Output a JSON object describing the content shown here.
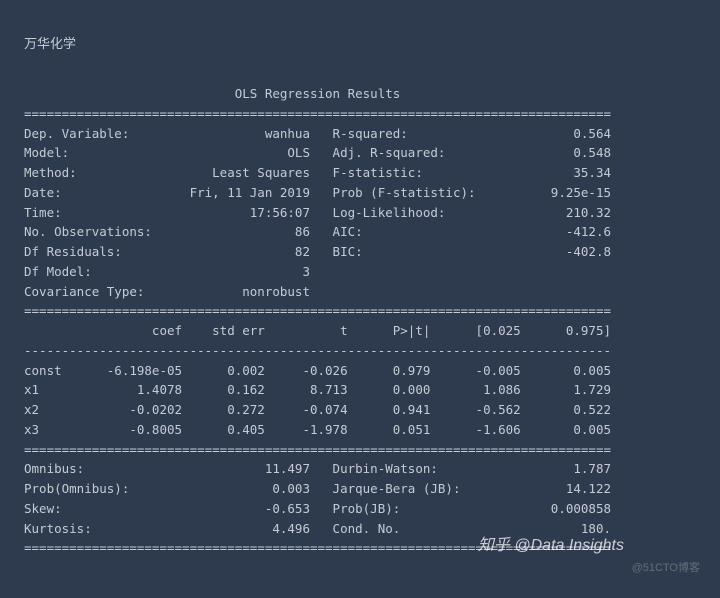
{
  "company_name_cn": "万华化学",
  "report_title": "OLS Regression Results",
  "divider_eq": "==============================================================================",
  "divider_dash": "------------------------------------------------------------------------------",
  "summary_left": [
    {
      "label": "Dep. Variable:",
      "value": "wanhua"
    },
    {
      "label": "Model:",
      "value": "OLS"
    },
    {
      "label": "Method:",
      "value": "Least Squares"
    },
    {
      "label": "Date:",
      "value": "Fri, 11 Jan 2019"
    },
    {
      "label": "Time:",
      "value": "17:56:07"
    },
    {
      "label": "No. Observations:",
      "value": "86"
    },
    {
      "label": "Df Residuals:",
      "value": "82"
    },
    {
      "label": "Df Model:",
      "value": "3"
    },
    {
      "label": "Covariance Type:",
      "value": "nonrobust"
    }
  ],
  "summary_right": [
    {
      "label": "R-squared:",
      "value": "0.564"
    },
    {
      "label": "Adj. R-squared:",
      "value": "0.548"
    },
    {
      "label": "F-statistic:",
      "value": "35.34"
    },
    {
      "label": "Prob (F-statistic):",
      "value": "9.25e-15"
    },
    {
      "label": "Log-Likelihood:",
      "value": "210.32"
    },
    {
      "label": "AIC:",
      "value": "-412.6"
    },
    {
      "label": "BIC:",
      "value": "-402.8"
    }
  ],
  "coef_header": [
    "",
    "coef",
    "std err",
    "t",
    "P>|t|",
    "[0.025",
    "0.975]"
  ],
  "coef_rows": [
    {
      "name": "const",
      "coef": "-6.198e-05",
      "stderr": "0.002",
      "t": "-0.026",
      "p": "0.979",
      "lo": "-0.005",
      "hi": "0.005"
    },
    {
      "name": "x1",
      "coef": "1.4078",
      "stderr": "0.162",
      "t": "8.713",
      "p": "0.000",
      "lo": "1.086",
      "hi": "1.729"
    },
    {
      "name": "x2",
      "coef": "-0.0202",
      "stderr": "0.272",
      "t": "-0.074",
      "p": "0.941",
      "lo": "-0.562",
      "hi": "0.522"
    },
    {
      "name": "x3",
      "coef": "-0.8005",
      "stderr": "0.405",
      "t": "-1.978",
      "p": "0.051",
      "lo": "-1.606",
      "hi": "0.005"
    }
  ],
  "diag_left": [
    {
      "label": "Omnibus:",
      "value": "11.497"
    },
    {
      "label": "Prob(Omnibus):",
      "value": "0.003"
    },
    {
      "label": "Skew:",
      "value": "-0.653"
    },
    {
      "label": "Kurtosis:",
      "value": "4.496"
    }
  ],
  "diag_right": [
    {
      "label": "Durbin-Watson:",
      "value": "1.787"
    },
    {
      "label": "Jarque-Bera (JB):",
      "value": "14.122"
    },
    {
      "label": "Prob(JB):",
      "value": "0.000858"
    },
    {
      "label": "Cond. No.",
      "value": "180."
    }
  ],
  "watermark": "知乎 @Data Insights",
  "watermark2": "@51CTO博客"
}
